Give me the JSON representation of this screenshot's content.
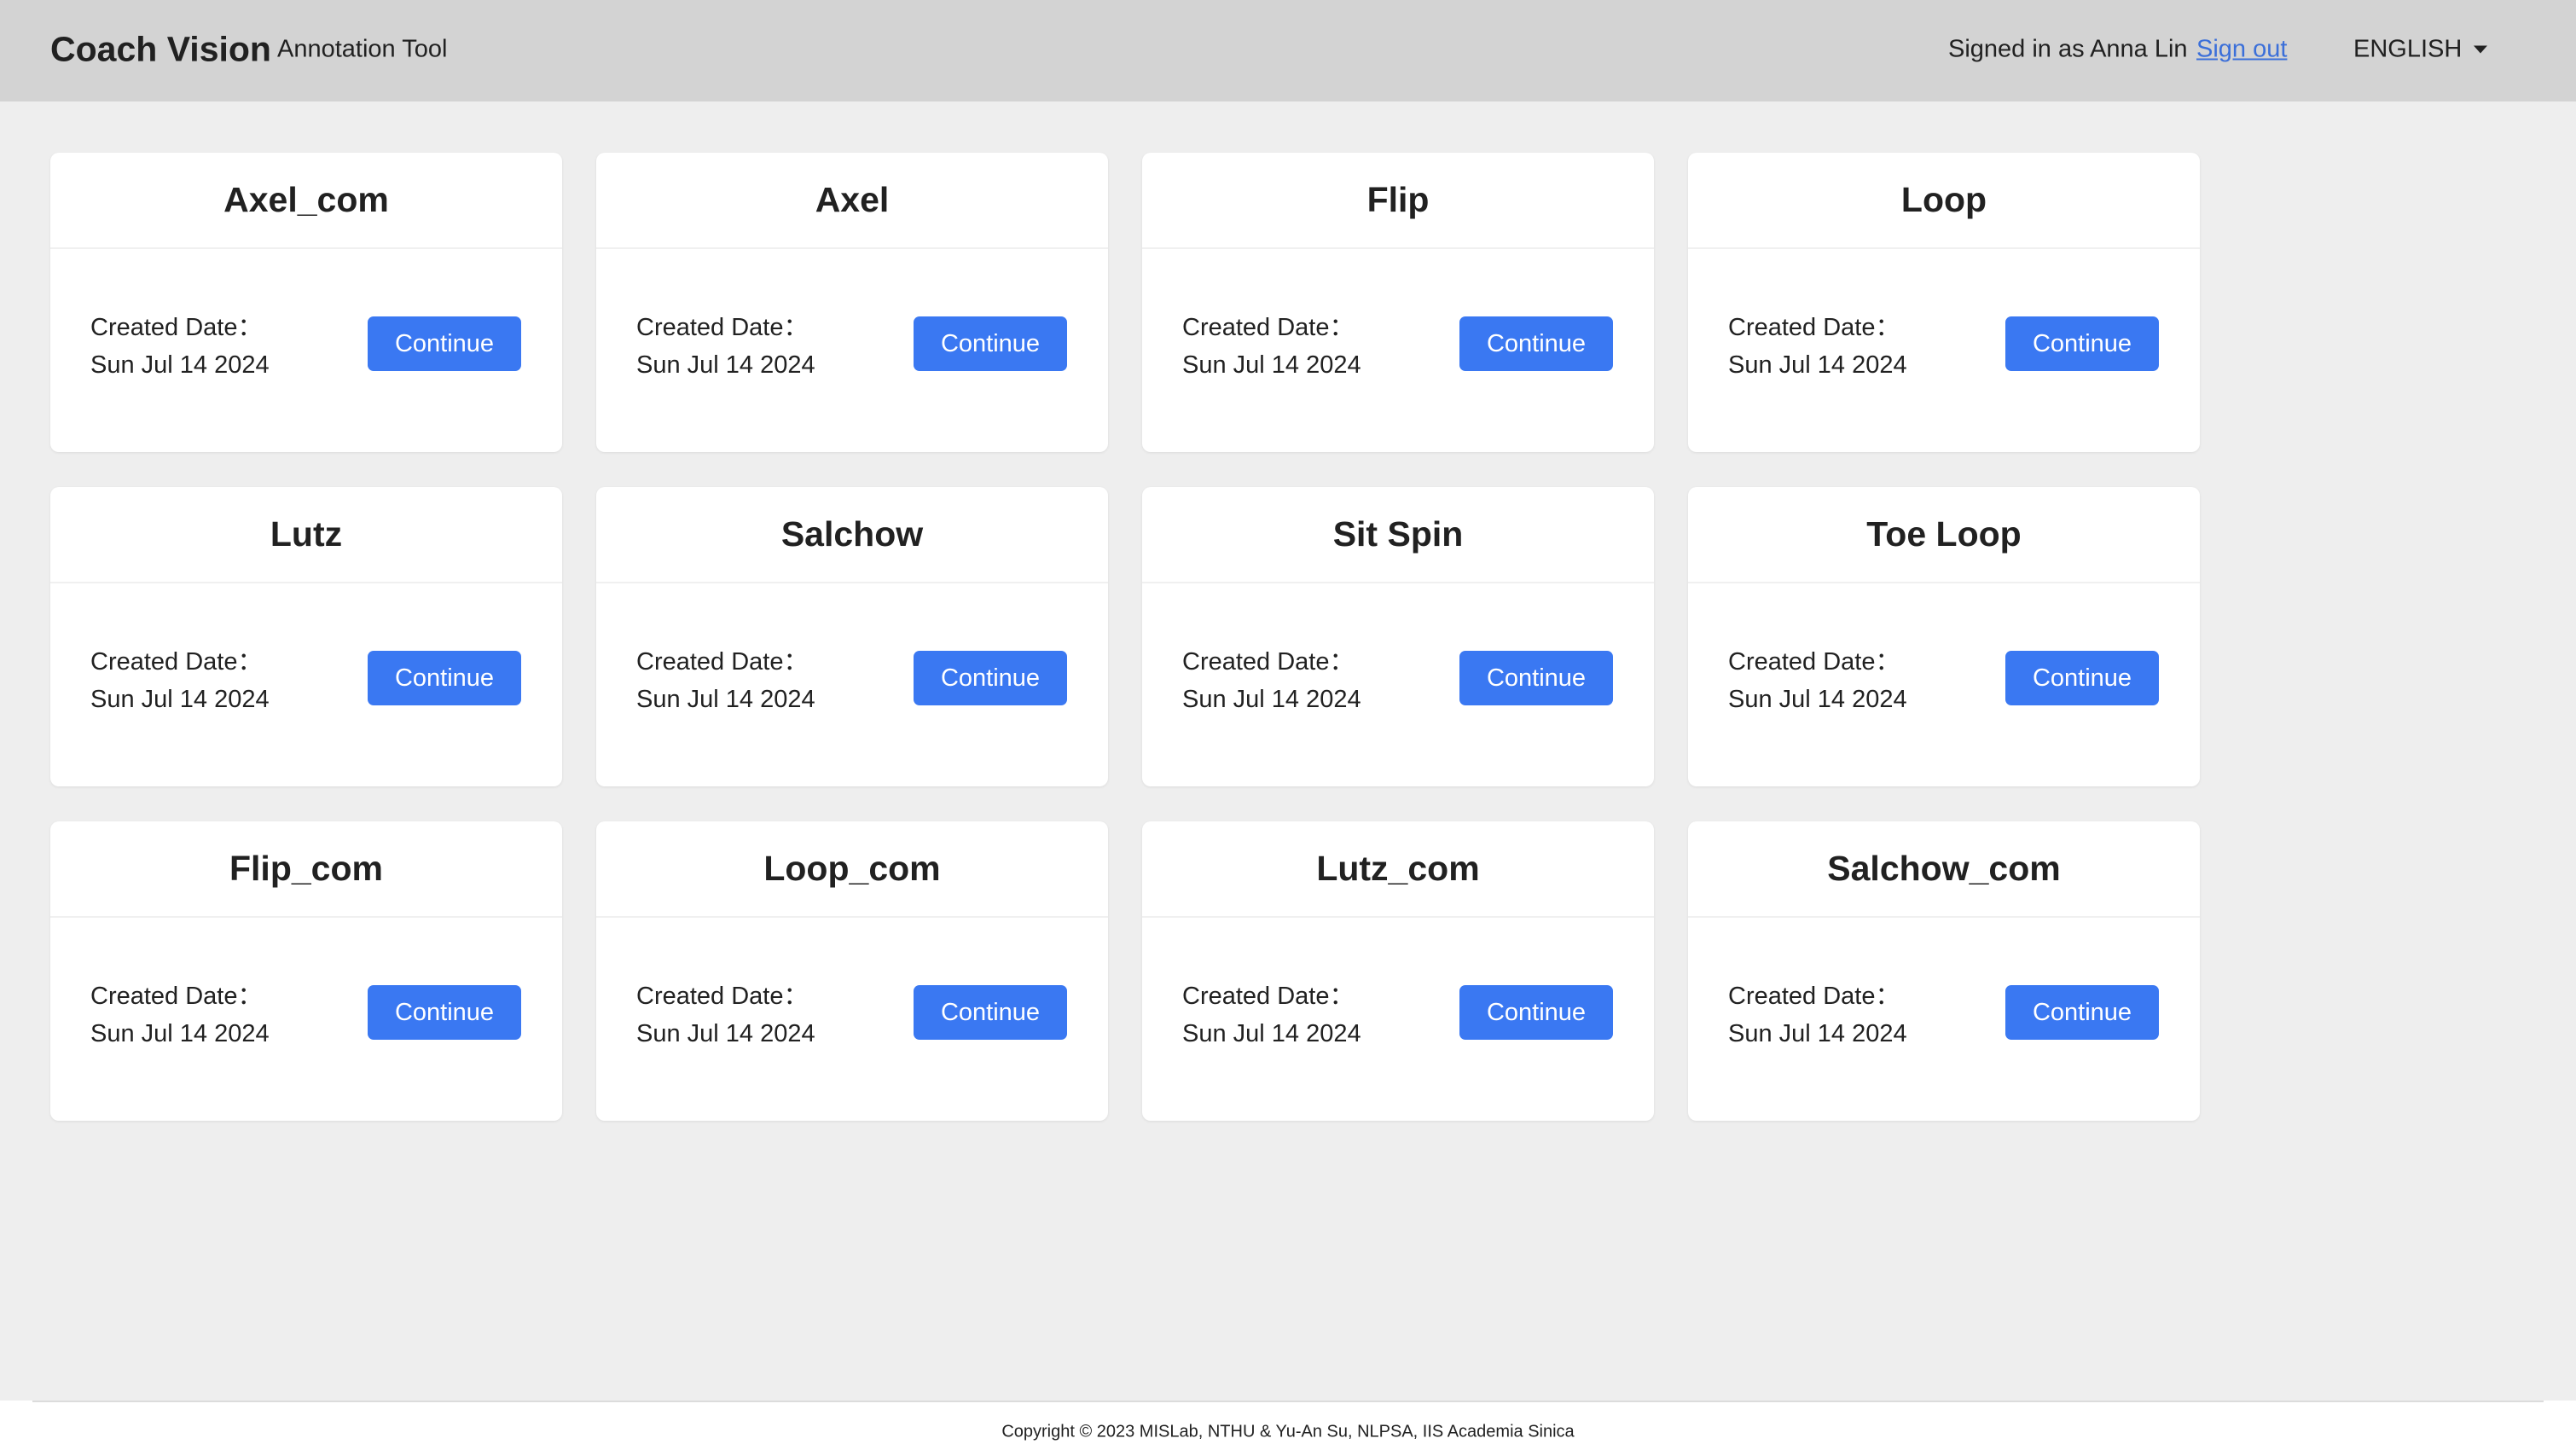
{
  "header": {
    "brand": "Coach Vision",
    "subtitle": "Annotation Tool",
    "signed_in_text": "Signed in as Anna Lin",
    "signout_label": "Sign out",
    "language": "ENGLISH"
  },
  "projects": [
    {
      "title": "Axel_com",
      "date_label": "Created Date：",
      "date": "Sun Jul 14 2024",
      "button_label": "Continue"
    },
    {
      "title": "Axel",
      "date_label": "Created Date：",
      "date": "Sun Jul 14 2024",
      "button_label": "Continue"
    },
    {
      "title": "Flip",
      "date_label": "Created Date：",
      "date": "Sun Jul 14 2024",
      "button_label": "Continue"
    },
    {
      "title": "Loop",
      "date_label": "Created Date：",
      "date": "Sun Jul 14 2024",
      "button_label": "Continue"
    },
    {
      "title": "Lutz",
      "date_label": "Created Date：",
      "date": "Sun Jul 14 2024",
      "button_label": "Continue"
    },
    {
      "title": "Salchow",
      "date_label": "Created Date：",
      "date": "Sun Jul 14 2024",
      "button_label": "Continue"
    },
    {
      "title": "Sit Spin",
      "date_label": "Created Date：",
      "date": "Sun Jul 14 2024",
      "button_label": "Continue"
    },
    {
      "title": "Toe Loop",
      "date_label": "Created Date：",
      "date": "Sun Jul 14 2024",
      "button_label": "Continue"
    },
    {
      "title": "Flip_com",
      "date_label": "Created Date：",
      "date": "Sun Jul 14 2024",
      "button_label": "Continue"
    },
    {
      "title": "Loop_com",
      "date_label": "Created Date：",
      "date": "Sun Jul 14 2024",
      "button_label": "Continue"
    },
    {
      "title": "Lutz_com",
      "date_label": "Created Date：",
      "date": "Sun Jul 14 2024",
      "button_label": "Continue"
    },
    {
      "title": "Salchow_com",
      "date_label": "Created Date：",
      "date": "Sun Jul 14 2024",
      "button_label": "Continue"
    }
  ],
  "footer": {
    "copyright": "Copyright © 2023 MISLab, NTHU & Yu-An Su, NLPSA, IIS Academia Sinica"
  },
  "colors": {
    "header_bg": "#d3d3d3",
    "page_bg": "#eeeeee",
    "accent": "#3a78f2",
    "link": "#3b6fd9"
  },
  "icons": {
    "language_dropdown": "caret-down-icon"
  }
}
